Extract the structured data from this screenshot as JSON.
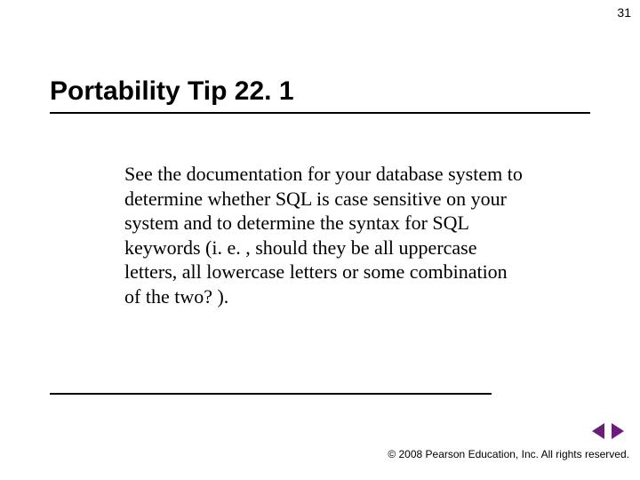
{
  "page_number": "31",
  "title": "Portability Tip 22. 1",
  "body": "See the documentation for your database system to determine whether SQL is case sensitive on your system and to determine the syntax for SQL keywords (i. e. , should they be all uppercase letters, all lowercase letters or some combination of the two? ).",
  "footer": "© 2008 Pearson Education, Inc. All rights reserved.",
  "nav": {
    "prev": "Previous slide",
    "next": "Next slide"
  },
  "colors": {
    "nav_arrow": "#6a1e7a"
  }
}
